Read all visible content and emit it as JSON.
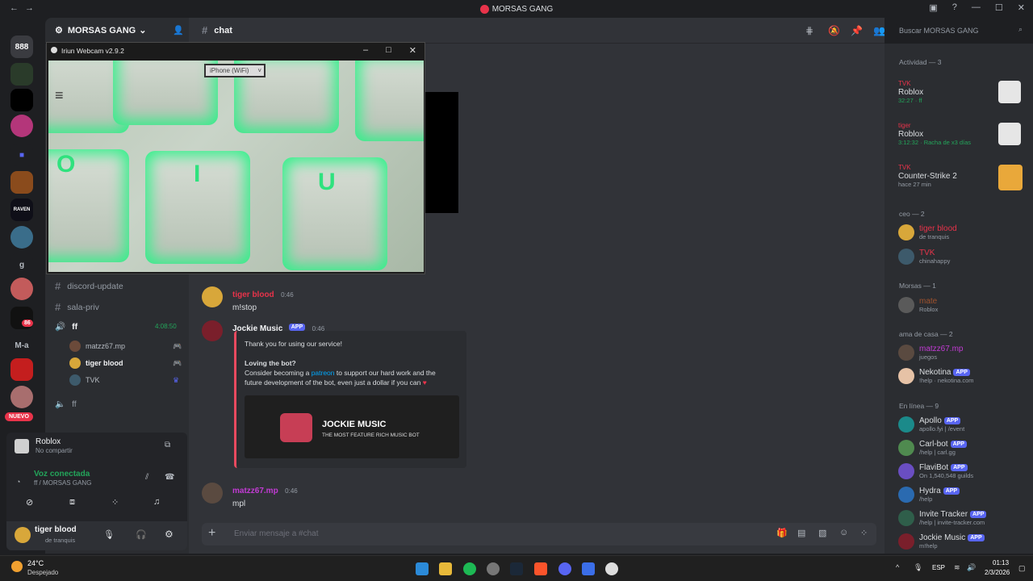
{
  "window": {
    "title": "MORSAS GANG"
  },
  "server": {
    "name": "MORSAS GANG"
  },
  "rail": {
    "labels": [
      "888",
      "RAVEN",
      "g",
      "M-a",
      "NUEVO"
    ],
    "badge": "86"
  },
  "channels": {
    "header_channel": "chat",
    "text": [
      {
        "name": "discord-update"
      },
      {
        "name": "sala-priv"
      }
    ],
    "voice_ff": {
      "name": "ff",
      "time": "4:08:50",
      "users": [
        {
          "name": "matzz67.mp"
        },
        {
          "name": "tiger blood"
        },
        {
          "name": "TVK"
        }
      ]
    },
    "voice_ff2": {
      "name": "ff"
    }
  },
  "activity_card": {
    "title": "Roblox",
    "subtitle": "No compartir"
  },
  "voice": {
    "status": "Voz conectada",
    "where": "ff / MORSAS GANG"
  },
  "user": {
    "name": "tiger blood",
    "status": "de tranquis"
  },
  "search": {
    "placeholder": "Buscar MORSAS GANG"
  },
  "webcam": {
    "title": "Iriun Webcam v2.9.2",
    "device": "iPhone (WiFi)",
    "keys": [
      "O",
      "I",
      "U"
    ]
  },
  "messages": [
    {
      "user": "tiger blood",
      "time": "0:46",
      "text": "m!stop",
      "color": "#e8334a"
    },
    {
      "user": "Jockie Music",
      "badge": "APP",
      "time": "0:46",
      "color": "#f2f3f5"
    },
    {
      "user": "matzz67.mp",
      "time": "0:46",
      "text": "mpl",
      "color": "#c23bd4"
    }
  ],
  "embed": {
    "line1": "Thank you for using our service!",
    "heading": "Loving the bot?",
    "line2a": "Consider becoming a ",
    "link": "patreon",
    "line2b": " to support our hard work and the",
    "line3": "future development of the bot, even just a dollar if you can",
    "brand": "JOCKIE MUSIC",
    "tagline": "THE MOST FEATURE RICH MUSIC BOT"
  },
  "composer": {
    "placeholder": "Enviar mensaje a #chat"
  },
  "members": {
    "activity_header": "Actividad — 3",
    "activities": [
      {
        "name": "TVK",
        "game": "Roblox",
        "detail": "32:27 · ff"
      },
      {
        "name": "tiger",
        "game": "Roblox",
        "detail": "3:12:32 · Racha de x3 días"
      },
      {
        "name": "TVK",
        "game": "Counter-Strike 2",
        "detail": "hace 27 min"
      }
    ],
    "groups": [
      {
        "title": "ceo — 2",
        "items": [
          {
            "name": "tiger blood",
            "sub": "de tranquis",
            "color": "#e8334a"
          },
          {
            "name": "TVK",
            "sub": "chinahappy",
            "color": "#e8334a"
          }
        ]
      },
      {
        "title": "Morsas — 1",
        "items": [
          {
            "name": "mate",
            "sub": "Roblox",
            "color": "#a0522d"
          }
        ]
      },
      {
        "title": "ama de casa — 2",
        "items": [
          {
            "name": "matzz67.mp",
            "sub": "juegos",
            "color": "#c23bd4"
          },
          {
            "name": "Nekotina",
            "badge": "APP",
            "sub": "!help · nekotina.com",
            "color": "#f2f3f5"
          }
        ]
      },
      {
        "title": "En línea — 9",
        "items": [
          {
            "name": "Apollo",
            "badge": "APP",
            "sub": "apollo.fyi | /event",
            "color": "#f2f3f5"
          },
          {
            "name": "Carl-bot",
            "badge": "APP",
            "sub": "/help | carl.gg",
            "color": "#f2f3f5"
          },
          {
            "name": "FlaviBot",
            "badge": "APP",
            "sub": "On 1,540,548 guilds",
            "color": "#b5bac1"
          },
          {
            "name": "Hydra",
            "badge": "APP",
            "sub": "/help",
            "color": "#f2f3f5"
          },
          {
            "name": "Invite Tracker",
            "badge": "APP",
            "sub": "/help | invite-tracker.com",
            "color": "#b5bac1"
          },
          {
            "name": "Jockie Music",
            "badge": "APP",
            "sub": "m!help",
            "color": "#b5bac1"
          }
        ]
      }
    ]
  },
  "taskbar": {
    "weather": "24°C",
    "weather_desc": "Despejado",
    "lang": "ESP",
    "time": "01:13",
    "date": "2/3/2026"
  }
}
